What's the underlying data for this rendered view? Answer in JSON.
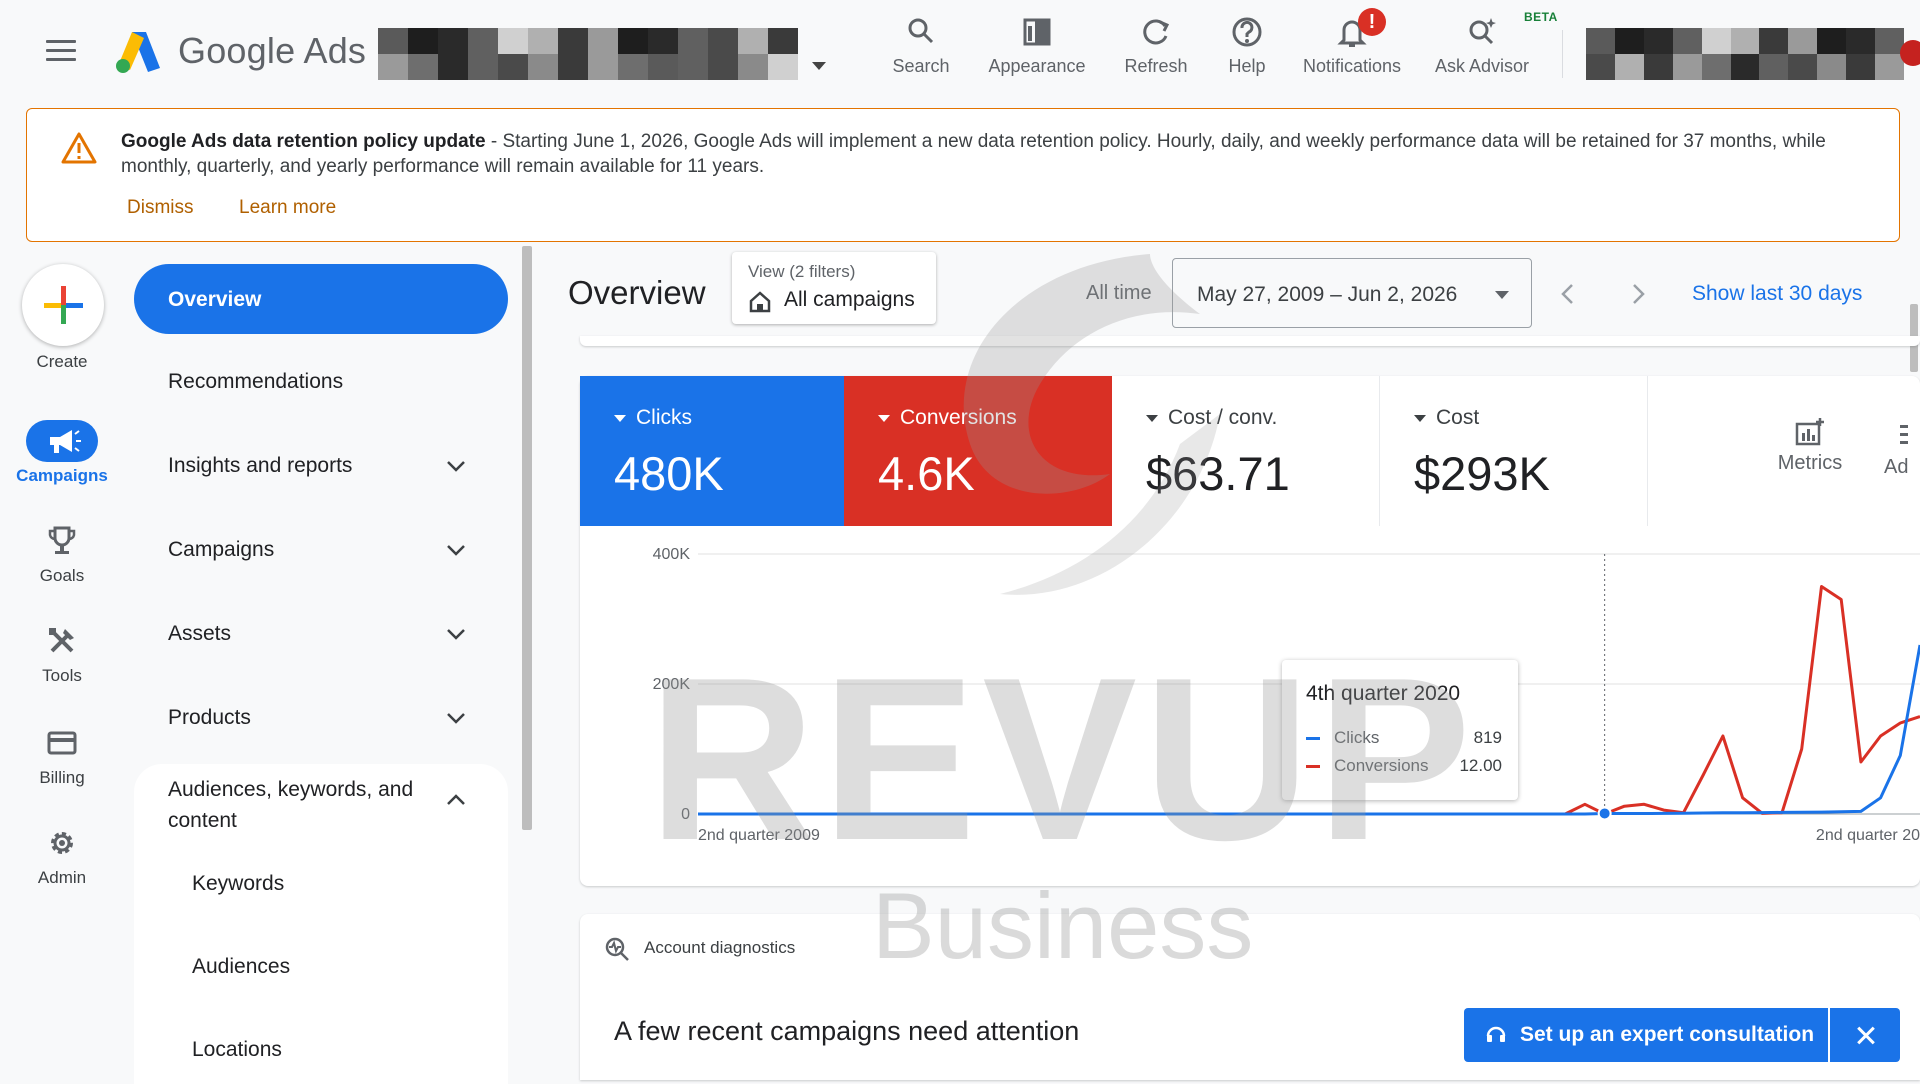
{
  "header": {
    "brand": "Google Ads",
    "tools": [
      {
        "icon": "search-icon",
        "label": "Search"
      },
      {
        "icon": "appearance-icon",
        "label": "Appearance"
      },
      {
        "icon": "refresh-icon",
        "label": "Refresh"
      },
      {
        "icon": "help-icon",
        "label": "Help"
      },
      {
        "icon": "notifications-icon",
        "label": "Notifications",
        "badge": "!"
      },
      {
        "icon": "ask-advisor-icon",
        "label": "Ask Advisor",
        "tag": "BETA"
      }
    ]
  },
  "banner": {
    "title": "Google Ads data retention policy update",
    "body": " - Starting June 1, 2026, Google Ads will implement a new data retention policy. Hourly, daily, and weekly performance data will be retained for 37 months, while monthly, quarterly, and yearly performance will remain available for 11 years.",
    "dismiss": "Dismiss",
    "learn_more": "Learn more"
  },
  "rail": {
    "create": "Create",
    "campaigns": "Campaigns",
    "goals": "Goals",
    "tools": "Tools",
    "billing": "Billing",
    "admin": "Admin"
  },
  "nav": {
    "overview": "Overview",
    "recommendations": "Recommendations",
    "insights": "Insights and reports",
    "campaigns": "Campaigns",
    "assets": "Assets",
    "products": "Products",
    "audiences_line1": "Audiences, keywords, and",
    "audiences_line2": "content",
    "sub": [
      "Keywords",
      "Audiences",
      "Locations"
    ]
  },
  "main": {
    "title": "Overview",
    "view_label": "View (2 filters)",
    "view_value": "All campaigns",
    "range_label": "All time",
    "date_range": "May 27, 2009 – Jun 2, 2026",
    "show_last": "Show last 30 days"
  },
  "metrics": [
    {
      "label": "Clicks",
      "value": "480K",
      "color": "#1a73e8"
    },
    {
      "label": "Conversions",
      "value": "4.6K",
      "color": "#d93025"
    },
    {
      "label": "Cost / conv.",
      "value": "$63.71"
    },
    {
      "label": "Cost",
      "value": "$293K"
    }
  ],
  "metrics_button": "Metrics",
  "ad_button": "Ad",
  "chart_data": {
    "type": "line",
    "ylim": [
      0,
      400000
    ],
    "y_ticks": [
      "400K",
      "200K",
      "0"
    ],
    "x_start_label": "2nd quarter 2009",
    "x_end_label": "2nd quarter 20",
    "series": [
      {
        "name": "Clicks",
        "color": "#1a73e8",
        "values": [
          0,
          0,
          0,
          0,
          0,
          0,
          0,
          0,
          0,
          0,
          0,
          0,
          0,
          0,
          0,
          0,
          0,
          0,
          0,
          0,
          0,
          0,
          0,
          0,
          0,
          0,
          0,
          0,
          0,
          0,
          0,
          0,
          0,
          0,
          0,
          0,
          0,
          0,
          0,
          0,
          0,
          0,
          0,
          0,
          0,
          0,
          819,
          800,
          700,
          900,
          1200,
          1500,
          1800,
          2000,
          2200,
          2500,
          2800,
          3000,
          3500,
          4000,
          25000,
          90000,
          260000
        ]
      },
      {
        "name": "Conversions",
        "color": "#d93025",
        "values": [
          0,
          0,
          0,
          0,
          0,
          0,
          0,
          0,
          0,
          0,
          0,
          0,
          0,
          0,
          0,
          0,
          0,
          0,
          0,
          0,
          0,
          0,
          0,
          0,
          0,
          0,
          0,
          0,
          0,
          0,
          0,
          0,
          0,
          0,
          0,
          0,
          0,
          0,
          0,
          0,
          0,
          0,
          0,
          0,
          0,
          15000,
          12,
          12000,
          15000,
          6000,
          2000,
          60000,
          120000,
          25000,
          1000,
          2000,
          100000,
          350000,
          330000,
          80000,
          120000,
          140000,
          150000
        ]
      }
    ],
    "tooltip": {
      "title": "4th quarter 2020",
      "rows": [
        {
          "name": "Clicks",
          "value": "819",
          "color": "#1a73e8"
        },
        {
          "name": "Conversions",
          "value": "12.00",
          "color": "#d93025"
        }
      ]
    }
  },
  "diagnostics": {
    "title": "Account diagnostics",
    "headline": "A few recent campaigns need attention",
    "expert_button": "Set up an expert consultation"
  },
  "watermark": {
    "word": "REVUP",
    "sub": "Business"
  }
}
